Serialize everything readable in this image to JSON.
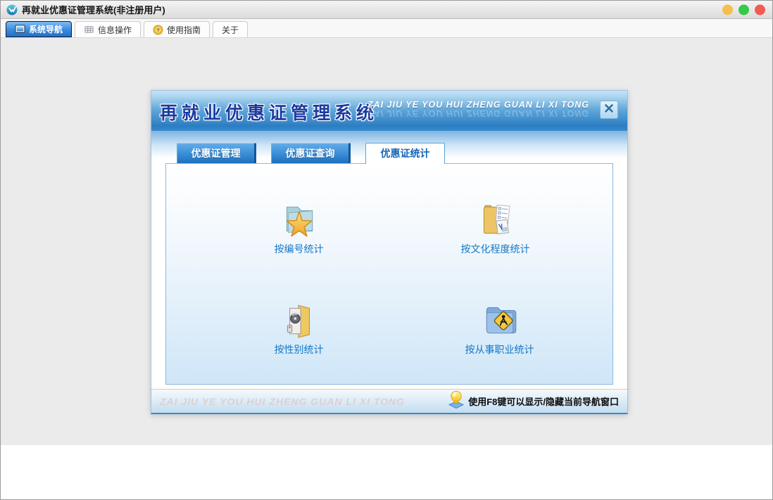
{
  "window": {
    "title": "再就业优惠证管理系统(非注册用户)"
  },
  "titlebar_buttons": {
    "minimize_color": "#f6be4f",
    "zoom_color": "#35c948",
    "close_color": "#f25a52"
  },
  "toolbar": {
    "tabs": [
      {
        "label": "系统导航",
        "icon": "monitor-icon",
        "active": true
      },
      {
        "label": "信息操作",
        "icon": "grid-icon",
        "active": false
      },
      {
        "label": "使用指南",
        "icon": "help-coin-icon",
        "active": false
      },
      {
        "label": "关于",
        "icon": "",
        "active": false
      }
    ]
  },
  "dialog": {
    "title": "再就业优惠证管理系统",
    "subtitle": "ZAI JIU YE YOU HUI ZHENG GUAN LI XI TONG",
    "tabs": [
      {
        "label": "优惠证管理",
        "active": false
      },
      {
        "label": "优惠证查询",
        "active": false
      },
      {
        "label": "优惠证统计",
        "active": true
      }
    ],
    "items": [
      {
        "label": "按编号统计",
        "icon": "folder-star-icon"
      },
      {
        "label": "按文化程度统计",
        "icon": "folder-documents-icon"
      },
      {
        "label": "按性别统计",
        "icon": "folder-disc-icon"
      },
      {
        "label": "按从事职业统计",
        "icon": "folder-roadsign-icon"
      }
    ],
    "footer": {
      "watermark": "ZAI JIU YE YOU HUI ZHENG GUAN LI XI TONG",
      "tip": "使用F8键可以显示/隐藏当前导航窗口"
    }
  },
  "colors": {
    "header_blue": "#2e82c6",
    "tab_blue": "#2277cc",
    "label_blue": "#1478c8",
    "panel_fade_blue": "#cfe6f7",
    "footer_line_orange": "#edc88e"
  }
}
